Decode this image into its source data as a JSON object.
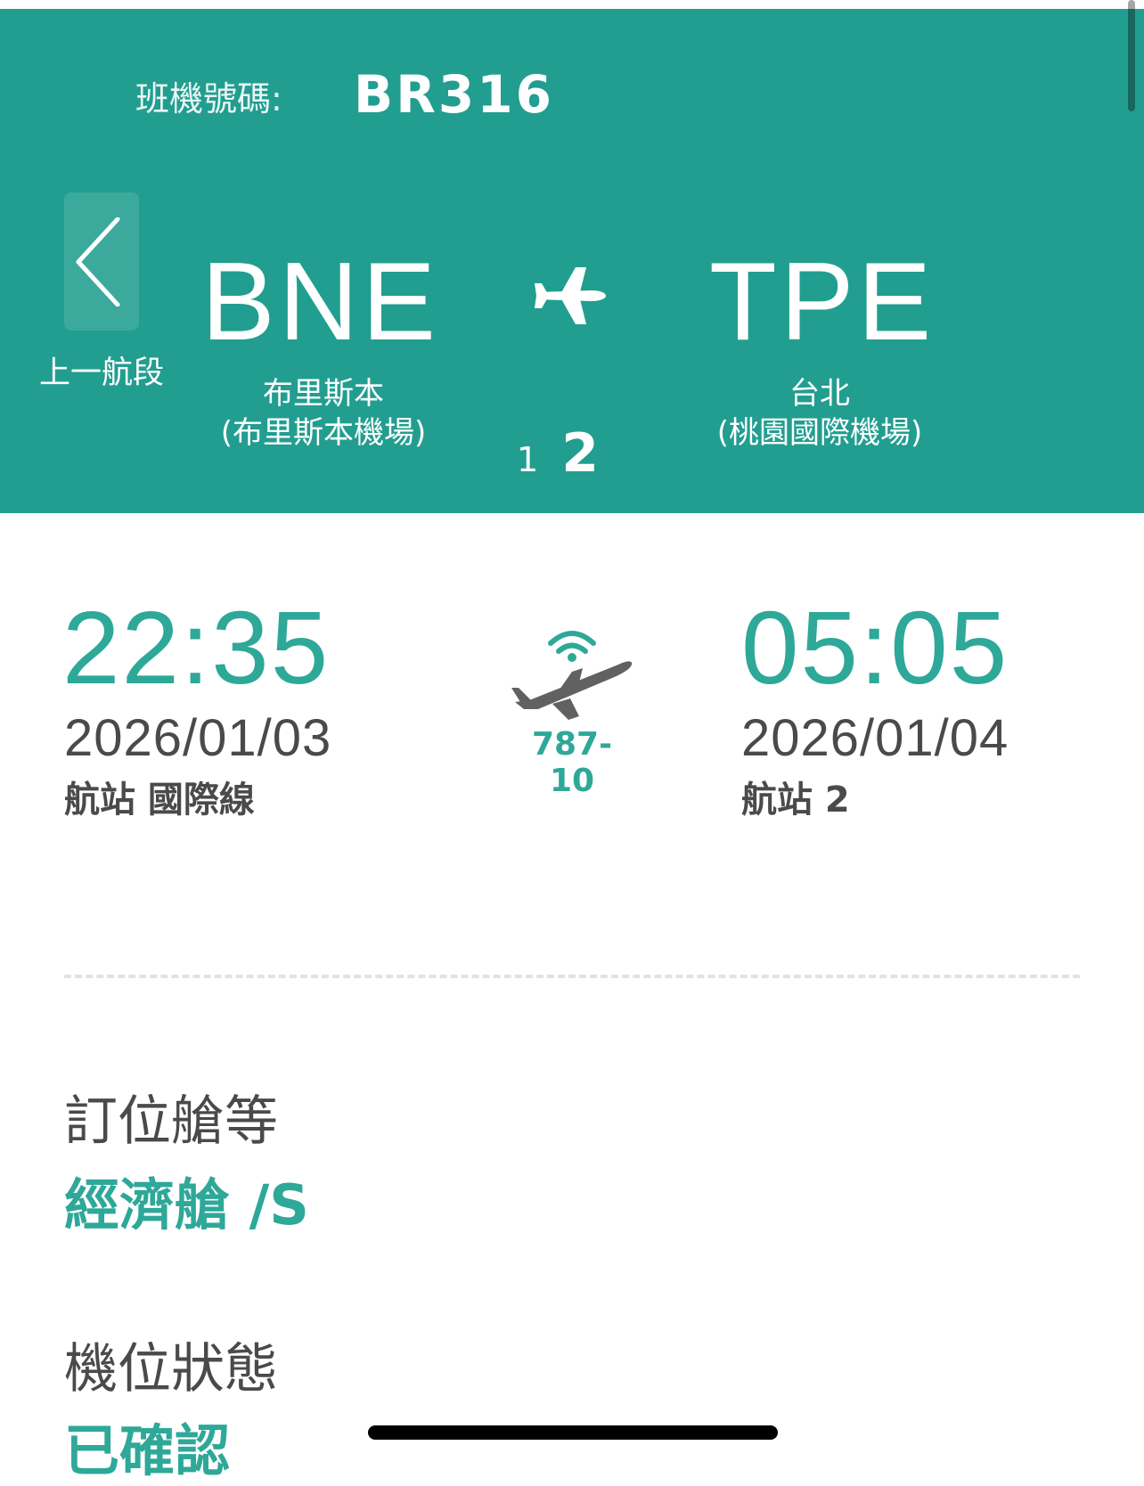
{
  "header": {
    "flight_label": "班機號碼:",
    "flight_number": "BR316",
    "back_label": "上一航段",
    "origin": {
      "code": "BNE",
      "city": "布里斯本",
      "airport": "(布里斯本機場)"
    },
    "destination": {
      "code": "TPE",
      "city": "台北",
      "airport": "(桃園國際機場)"
    },
    "segments": {
      "first": "1",
      "current": "2"
    }
  },
  "schedule": {
    "departure": {
      "time": "22:35",
      "date": "2026/01/03",
      "terminal": "航站 國際線"
    },
    "arrival": {
      "time": "05:05",
      "date": "2026/01/04",
      "terminal": "航站 2"
    },
    "aircraft": "787-10"
  },
  "details": {
    "cabin_label": "訂位艙等",
    "cabin_value": "經濟艙 /S",
    "status_label": "機位狀態",
    "status_value": "已確認"
  },
  "colors": {
    "header_bg": "#229e90",
    "accent": "#2ea898",
    "text": "#4a4a4a"
  },
  "icons": [
    "chevron-left-icon",
    "airplane-icon",
    "wifi-airplane-icon"
  ]
}
